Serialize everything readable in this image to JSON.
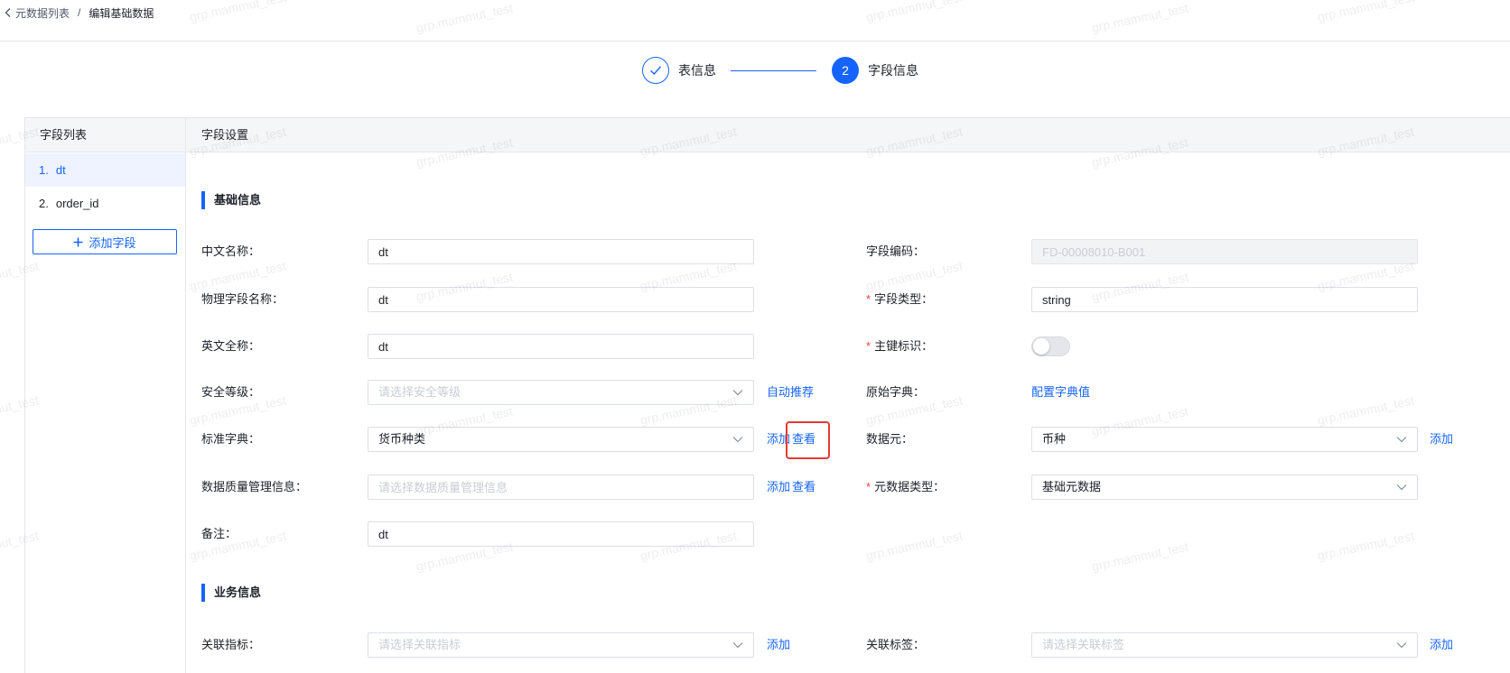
{
  "breadcrumb": {
    "back_icon": "chevron-left-icon",
    "parent": "元数据列表",
    "separator": "/",
    "current": "编辑基础数据"
  },
  "steps": [
    {
      "icon": "check-icon",
      "label": "表信息",
      "completed": true
    },
    {
      "number": "2",
      "label": "字段信息",
      "current": true
    }
  ],
  "field_list": {
    "title": "字段列表",
    "items": [
      {
        "index": "1.",
        "name": "dt",
        "selected": true
      },
      {
        "index": "2.",
        "name": "order_id",
        "selected": false
      }
    ],
    "add_button": {
      "icon": "plus-icon",
      "label": "添加字段"
    }
  },
  "field_settings": {
    "title": "字段设置",
    "required_mark": "*",
    "basic_info": {
      "title": "基础信息",
      "chinese_name": {
        "label": "中文名称：",
        "value": "dt"
      },
      "physical_name": {
        "label": "物理字段名称：",
        "value": "dt"
      },
      "english_name": {
        "label": "英文全称：",
        "value": "dt"
      },
      "security_level": {
        "label": "安全等级：",
        "placeholder": "请选择安全等级",
        "action": "自动推荐"
      },
      "standard_dict": {
        "label": "标准字典：",
        "value": "货币种类",
        "actions": [
          "添加",
          "查看"
        ]
      },
      "dq_info": {
        "label": "数据质量管理信息：",
        "placeholder": "请选择数据质量管理信息",
        "actions": [
          "添加",
          "查看"
        ]
      },
      "remark": {
        "label": "备注：",
        "value": "dt"
      },
      "field_code": {
        "label": "字段编码：",
        "value": "FD-00008010-B001",
        "disabled": true
      },
      "field_type": {
        "label": "字段类型：",
        "value": "string",
        "required": true
      },
      "primary_key": {
        "label": "主键标识：",
        "checked": false,
        "required": true
      },
      "source_dict": {
        "label": "原始字典：",
        "link": "配置字典值"
      },
      "data_element": {
        "label": "数据元：",
        "value": "币种",
        "action": "添加"
      },
      "metadata_type": {
        "label": "元数据类型：",
        "value": "基础元数据",
        "required": true
      }
    },
    "business_info": {
      "title": "业务信息",
      "related_metric": {
        "label": "关联指标：",
        "placeholder": "请选择关联指标",
        "action": "添加"
      },
      "related_tag": {
        "label": "关联标签：",
        "placeholder": "请选择关联标签",
        "action": "添加"
      }
    }
  },
  "watermark": "grp.mammut_test",
  "colors": {
    "primary": "#1664ff",
    "required": "#f53f3f",
    "highlight": "#e53935",
    "border": "#e5e6eb",
    "header_bg": "#f5f6f7",
    "selected_bg": "#eef3ff",
    "text": "#1d2129",
    "text_secondary": "#4e5969",
    "placeholder": "#c9cdd4",
    "disabled_bg": "#f2f3f5"
  }
}
